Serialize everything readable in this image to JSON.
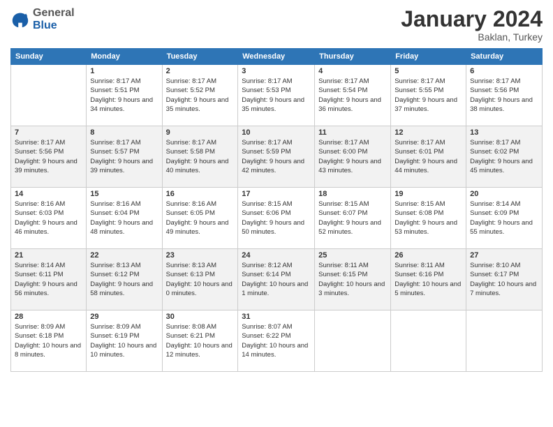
{
  "header": {
    "logo_general": "General",
    "logo_blue": "Blue",
    "month_title": "January 2024",
    "location": "Baklan, Turkey"
  },
  "days_of_week": [
    "Sunday",
    "Monday",
    "Tuesday",
    "Wednesday",
    "Thursday",
    "Friday",
    "Saturday"
  ],
  "weeks": [
    [
      {
        "day": "",
        "sunrise": "",
        "sunset": "",
        "daylight": ""
      },
      {
        "day": "1",
        "sunrise": "Sunrise: 8:17 AM",
        "sunset": "Sunset: 5:51 PM",
        "daylight": "Daylight: 9 hours and 34 minutes."
      },
      {
        "day": "2",
        "sunrise": "Sunrise: 8:17 AM",
        "sunset": "Sunset: 5:52 PM",
        "daylight": "Daylight: 9 hours and 35 minutes."
      },
      {
        "day": "3",
        "sunrise": "Sunrise: 8:17 AM",
        "sunset": "Sunset: 5:53 PM",
        "daylight": "Daylight: 9 hours and 35 minutes."
      },
      {
        "day": "4",
        "sunrise": "Sunrise: 8:17 AM",
        "sunset": "Sunset: 5:54 PM",
        "daylight": "Daylight: 9 hours and 36 minutes."
      },
      {
        "day": "5",
        "sunrise": "Sunrise: 8:17 AM",
        "sunset": "Sunset: 5:55 PM",
        "daylight": "Daylight: 9 hours and 37 minutes."
      },
      {
        "day": "6",
        "sunrise": "Sunrise: 8:17 AM",
        "sunset": "Sunset: 5:56 PM",
        "daylight": "Daylight: 9 hours and 38 minutes."
      }
    ],
    [
      {
        "day": "7",
        "sunrise": "Sunrise: 8:17 AM",
        "sunset": "Sunset: 5:56 PM",
        "daylight": "Daylight: 9 hours and 39 minutes."
      },
      {
        "day": "8",
        "sunrise": "Sunrise: 8:17 AM",
        "sunset": "Sunset: 5:57 PM",
        "daylight": "Daylight: 9 hours and 39 minutes."
      },
      {
        "day": "9",
        "sunrise": "Sunrise: 8:17 AM",
        "sunset": "Sunset: 5:58 PM",
        "daylight": "Daylight: 9 hours and 40 minutes."
      },
      {
        "day": "10",
        "sunrise": "Sunrise: 8:17 AM",
        "sunset": "Sunset: 5:59 PM",
        "daylight": "Daylight: 9 hours and 42 minutes."
      },
      {
        "day": "11",
        "sunrise": "Sunrise: 8:17 AM",
        "sunset": "Sunset: 6:00 PM",
        "daylight": "Daylight: 9 hours and 43 minutes."
      },
      {
        "day": "12",
        "sunrise": "Sunrise: 8:17 AM",
        "sunset": "Sunset: 6:01 PM",
        "daylight": "Daylight: 9 hours and 44 minutes."
      },
      {
        "day": "13",
        "sunrise": "Sunrise: 8:17 AM",
        "sunset": "Sunset: 6:02 PM",
        "daylight": "Daylight: 9 hours and 45 minutes."
      }
    ],
    [
      {
        "day": "14",
        "sunrise": "Sunrise: 8:16 AM",
        "sunset": "Sunset: 6:03 PM",
        "daylight": "Daylight: 9 hours and 46 minutes."
      },
      {
        "day": "15",
        "sunrise": "Sunrise: 8:16 AM",
        "sunset": "Sunset: 6:04 PM",
        "daylight": "Daylight: 9 hours and 48 minutes."
      },
      {
        "day": "16",
        "sunrise": "Sunrise: 8:16 AM",
        "sunset": "Sunset: 6:05 PM",
        "daylight": "Daylight: 9 hours and 49 minutes."
      },
      {
        "day": "17",
        "sunrise": "Sunrise: 8:15 AM",
        "sunset": "Sunset: 6:06 PM",
        "daylight": "Daylight: 9 hours and 50 minutes."
      },
      {
        "day": "18",
        "sunrise": "Sunrise: 8:15 AM",
        "sunset": "Sunset: 6:07 PM",
        "daylight": "Daylight: 9 hours and 52 minutes."
      },
      {
        "day": "19",
        "sunrise": "Sunrise: 8:15 AM",
        "sunset": "Sunset: 6:08 PM",
        "daylight": "Daylight: 9 hours and 53 minutes."
      },
      {
        "day": "20",
        "sunrise": "Sunrise: 8:14 AM",
        "sunset": "Sunset: 6:09 PM",
        "daylight": "Daylight: 9 hours and 55 minutes."
      }
    ],
    [
      {
        "day": "21",
        "sunrise": "Sunrise: 8:14 AM",
        "sunset": "Sunset: 6:11 PM",
        "daylight": "Daylight: 9 hours and 56 minutes."
      },
      {
        "day": "22",
        "sunrise": "Sunrise: 8:13 AM",
        "sunset": "Sunset: 6:12 PM",
        "daylight": "Daylight: 9 hours and 58 minutes."
      },
      {
        "day": "23",
        "sunrise": "Sunrise: 8:13 AM",
        "sunset": "Sunset: 6:13 PM",
        "daylight": "Daylight: 10 hours and 0 minutes."
      },
      {
        "day": "24",
        "sunrise": "Sunrise: 8:12 AM",
        "sunset": "Sunset: 6:14 PM",
        "daylight": "Daylight: 10 hours and 1 minute."
      },
      {
        "day": "25",
        "sunrise": "Sunrise: 8:11 AM",
        "sunset": "Sunset: 6:15 PM",
        "daylight": "Daylight: 10 hours and 3 minutes."
      },
      {
        "day": "26",
        "sunrise": "Sunrise: 8:11 AM",
        "sunset": "Sunset: 6:16 PM",
        "daylight": "Daylight: 10 hours and 5 minutes."
      },
      {
        "day": "27",
        "sunrise": "Sunrise: 8:10 AM",
        "sunset": "Sunset: 6:17 PM",
        "daylight": "Daylight: 10 hours and 7 minutes."
      }
    ],
    [
      {
        "day": "28",
        "sunrise": "Sunrise: 8:09 AM",
        "sunset": "Sunset: 6:18 PM",
        "daylight": "Daylight: 10 hours and 8 minutes."
      },
      {
        "day": "29",
        "sunrise": "Sunrise: 8:09 AM",
        "sunset": "Sunset: 6:19 PM",
        "daylight": "Daylight: 10 hours and 10 minutes."
      },
      {
        "day": "30",
        "sunrise": "Sunrise: 8:08 AM",
        "sunset": "Sunset: 6:21 PM",
        "daylight": "Daylight: 10 hours and 12 minutes."
      },
      {
        "day": "31",
        "sunrise": "Sunrise: 8:07 AM",
        "sunset": "Sunset: 6:22 PM",
        "daylight": "Daylight: 10 hours and 14 minutes."
      },
      {
        "day": "",
        "sunrise": "",
        "sunset": "",
        "daylight": ""
      },
      {
        "day": "",
        "sunrise": "",
        "sunset": "",
        "daylight": ""
      },
      {
        "day": "",
        "sunrise": "",
        "sunset": "",
        "daylight": ""
      }
    ]
  ]
}
